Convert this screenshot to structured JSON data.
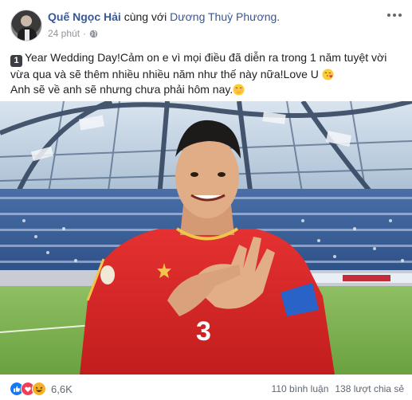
{
  "post": {
    "author": "Quế Ngọc Hải",
    "with_text": "cùng với",
    "partner": "Dương Thuỳ Phương.",
    "timestamp": "24 phút",
    "separator": "·",
    "privacy_icon": "globe-icon",
    "more_icon": "more-options-icon",
    "text_line1_keycap": "1",
    "text_line1": "Year Wedding Day!Cảm on e vì mọi điều đã diễn ra trong 1 năm tuyệt vời vừa qua và sẽ thêm nhiều nhiều năm như thế này nữa!Love U",
    "text_line1_emoji": "face-blowing-kiss-emoji",
    "text_line2": "Anh sẽ về anh sẽ nhưng chưa phải hôm nay.",
    "text_line2_emoji": "smiling-face-with-hand-over-mouth-emoji",
    "jersey_number": "3"
  },
  "footer": {
    "reactions": [
      "like",
      "love",
      "haha"
    ],
    "reaction_count": "6,6K",
    "comments": "110 bình luận",
    "shares": "138 lượt chia sẻ"
  },
  "colors": {
    "link": "#365899",
    "meta": "#90949c",
    "like": "#1877f2",
    "love": "#f33e58",
    "haha": "#f7b125"
  }
}
